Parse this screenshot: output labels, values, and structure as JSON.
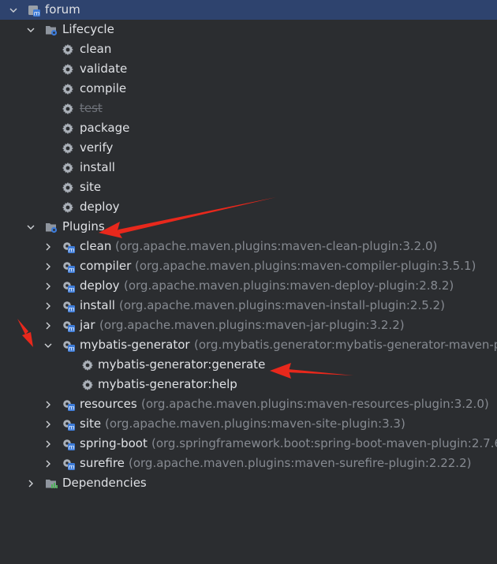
{
  "root": {
    "label": "forum",
    "icon": "maven-project-icon"
  },
  "lifecycle": {
    "label": "Lifecycle",
    "phases": [
      {
        "label": "clean",
        "disabled": false
      },
      {
        "label": "validate",
        "disabled": false
      },
      {
        "label": "compile",
        "disabled": false
      },
      {
        "label": "test",
        "disabled": true
      },
      {
        "label": "package",
        "disabled": false
      },
      {
        "label": "verify",
        "disabled": false
      },
      {
        "label": "install",
        "disabled": false
      },
      {
        "label": "site",
        "disabled": false
      },
      {
        "label": "deploy",
        "disabled": false
      }
    ]
  },
  "plugins": {
    "label": "Plugins",
    "items": [
      {
        "name": "clean",
        "coord": "(org.apache.maven.plugins:maven-clean-plugin:3.2.0)"
      },
      {
        "name": "compiler",
        "coord": "(org.apache.maven.plugins:maven-compiler-plugin:3.5.1)"
      },
      {
        "name": "deploy",
        "coord": "(org.apache.maven.plugins:maven-deploy-plugin:2.8.2)"
      },
      {
        "name": "install",
        "coord": "(org.apache.maven.plugins:maven-install-plugin:2.5.2)"
      },
      {
        "name": "jar",
        "coord": "(org.apache.maven.plugins:maven-jar-plugin:3.2.2)"
      },
      {
        "name": "mybatis-generator",
        "coord": "(org.mybatis.generator:mybatis-generator-maven-plu",
        "expanded": true,
        "goals": [
          "mybatis-generator:generate",
          "mybatis-generator:help"
        ]
      },
      {
        "name": "resources",
        "coord": "(org.apache.maven.plugins:maven-resources-plugin:3.2.0)"
      },
      {
        "name": "site",
        "coord": "(org.apache.maven.plugins:maven-site-plugin:3.3)"
      },
      {
        "name": "spring-boot",
        "coord": "(org.springframework.boot:spring-boot-maven-plugin:2.7.6"
      },
      {
        "name": "surefire",
        "coord": "(org.apache.maven.plugins:maven-surefire-plugin:2.22.2)"
      }
    ]
  },
  "dependencies": {
    "label": "Dependencies"
  },
  "colors": {
    "background": "#2b2d30",
    "selection": "#2e436e",
    "text": "#dfe1e5",
    "secondary_text": "#868a91",
    "annotation_arrow": "#e8281c"
  }
}
